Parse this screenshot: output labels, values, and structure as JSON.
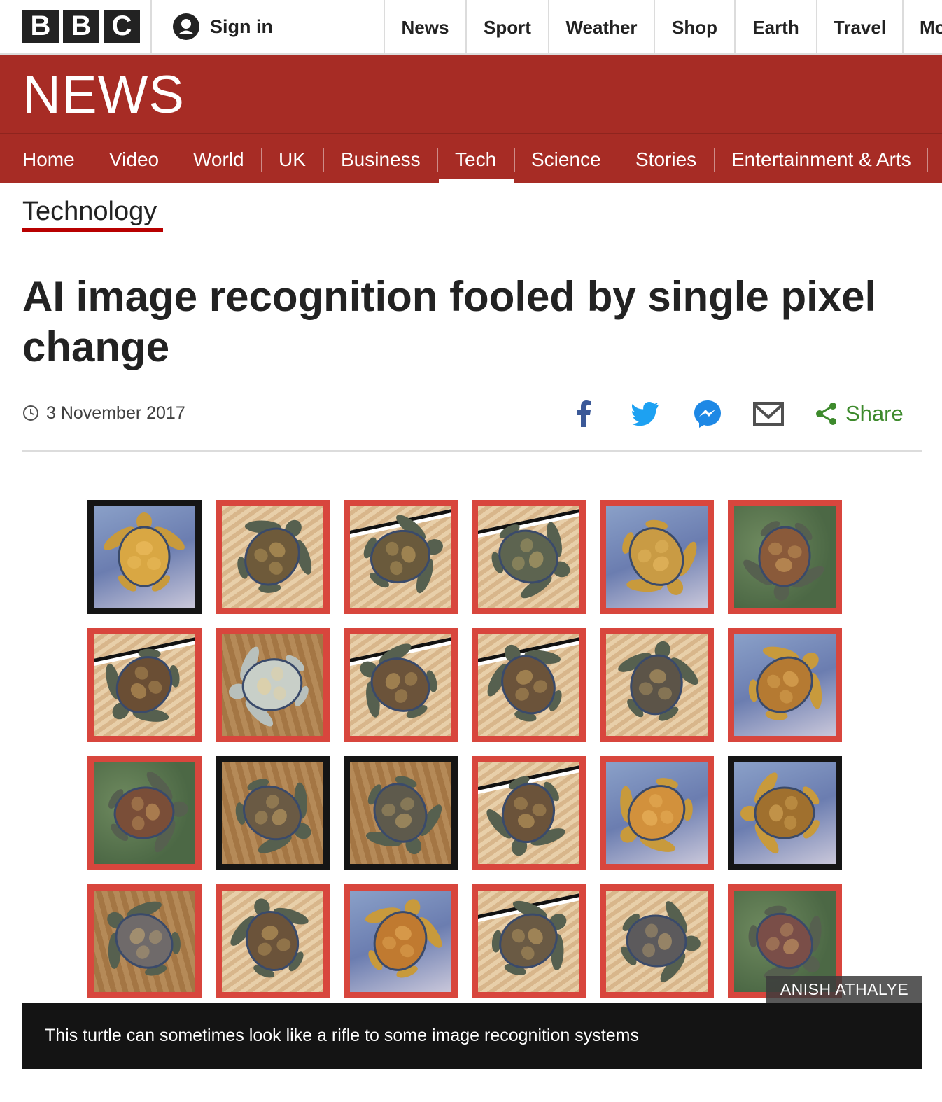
{
  "masthead": {
    "logo_letters": [
      "B",
      "B",
      "C"
    ],
    "sign_in": "Sign in",
    "nav": [
      "News",
      "Sport",
      "Weather",
      "Shop",
      "Earth",
      "Travel",
      "Mo"
    ]
  },
  "banner": {
    "title": "NEWS"
  },
  "section_nav": {
    "items": [
      "Home",
      "Video",
      "World",
      "UK",
      "Business",
      "Tech",
      "Science",
      "Stories",
      "Entertainment & Arts"
    ],
    "active": "Tech"
  },
  "article": {
    "section": "Technology",
    "headline": "AI image recognition fooled by single pixel change",
    "date": "3 November 2017",
    "share_label": "Share",
    "image_credit": "ANISH ATHALYE",
    "caption": "This turtle can sometimes look like a rifle to some image recognition systems"
  },
  "colors": {
    "brand_red": "#a72c25",
    "share_green": "#3d8a2c",
    "facebook": "#3b5998",
    "twitter": "#1da1f2",
    "messenger": "#1e88e5"
  },
  "share_icons": [
    "facebook-icon",
    "twitter-icon",
    "messenger-icon",
    "email-icon",
    "share-icon"
  ],
  "image_grid": {
    "rows": 4,
    "cols": 6,
    "frames": [
      "black",
      "red",
      "red",
      "red",
      "red",
      "red",
      "red",
      "red",
      "red",
      "red",
      "red",
      "red",
      "red",
      "black",
      "black",
      "red",
      "red",
      "black",
      "red",
      "red",
      "red",
      "red",
      "red",
      "red"
    ]
  }
}
